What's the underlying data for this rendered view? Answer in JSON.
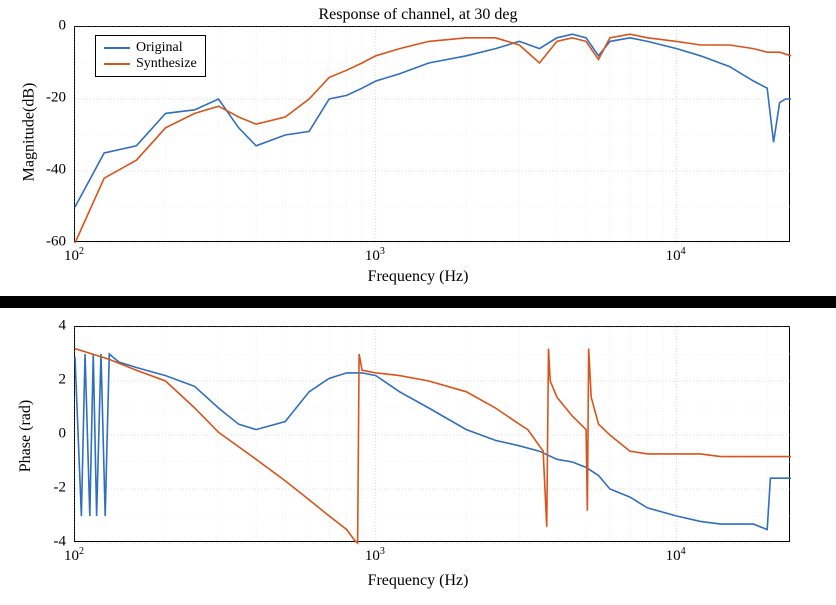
{
  "chart_data": [
    {
      "id": "top",
      "type": "line",
      "title": "Response of channel, at 30 deg",
      "xlabel": "Frequency (Hz)",
      "ylabel": "Magnitude(dB)",
      "x_scale": "log",
      "x_ticks": [
        100,
        1000,
        10000
      ],
      "x_tick_labels": [
        "10^2",
        "10^3",
        "10^4"
      ],
      "xlim": [
        100,
        24000
      ],
      "ylim": [
        -60,
        0
      ],
      "y_ticks": [
        -60,
        -40,
        -20,
        0
      ],
      "legend": {
        "items": [
          "Original",
          "Synthesize"
        ],
        "colors": [
          "#2f6fbe",
          "#d9541a"
        ]
      },
      "series": [
        {
          "name": "Original",
          "color": "#2f6fbe",
          "x": [
            100,
            125,
            160,
            200,
            250,
            300,
            350,
            400,
            500,
            600,
            700,
            800,
            900,
            1000,
            1200,
            1500,
            2000,
            2500,
            3000,
            3500,
            4000,
            4500,
            5000,
            5500,
            6000,
            7000,
            8000,
            10000,
            12000,
            15000,
            18000,
            20000,
            21000,
            22000,
            23000,
            24000
          ],
          "y": [
            -50,
            -35,
            -33,
            -24,
            -23,
            -20,
            -28,
            -33,
            -30,
            -29,
            -20,
            -19,
            -17,
            -15,
            -13,
            -10,
            -8,
            -6,
            -4,
            -6,
            -3,
            -2,
            -3,
            -8,
            -4,
            -3,
            -4,
            -6,
            -8,
            -11,
            -15,
            -17,
            -32,
            -21,
            -20,
            -20
          ]
        },
        {
          "name": "Synthesize",
          "color": "#d9541a",
          "x": [
            100,
            125,
            160,
            200,
            250,
            300,
            350,
            400,
            500,
            600,
            700,
            800,
            900,
            1000,
            1200,
            1500,
            2000,
            2500,
            3000,
            3500,
            4000,
            4500,
            5000,
            5500,
            6000,
            7000,
            8000,
            10000,
            12000,
            15000,
            18000,
            20000,
            22000,
            24000
          ],
          "y": [
            -60,
            -42,
            -37,
            -28,
            -24,
            -22,
            -25,
            -27,
            -25,
            -20,
            -14,
            -12,
            -10,
            -8,
            -6,
            -4,
            -3,
            -3,
            -5,
            -10,
            -4,
            -3,
            -4,
            -9,
            -3,
            -2,
            -3,
            -4,
            -5,
            -5,
            -6,
            -7,
            -7,
            -8
          ]
        }
      ]
    },
    {
      "id": "bottom",
      "type": "line",
      "xlabel": "Frequency (Hz)",
      "ylabel": "Phase (rad)",
      "x_scale": "log",
      "x_ticks": [
        100,
        1000,
        10000
      ],
      "x_tick_labels": [
        "10^2",
        "10^3",
        "10^4"
      ],
      "xlim": [
        100,
        24000
      ],
      "ylim": [
        -4,
        4
      ],
      "y_ticks": [
        -4,
        -2,
        0,
        2,
        4
      ],
      "series": [
        {
          "name": "Original",
          "color": "#2f6fbe",
          "x": [
            100,
            105,
            108,
            112,
            115,
            118,
            122,
            126,
            130,
            140,
            160,
            200,
            250,
            300,
            350,
            400,
            500,
            600,
            700,
            800,
            850,
            900,
            1000,
            1200,
            1500,
            2000,
            2500,
            3000,
            3500,
            4000,
            4500,
            5000,
            5500,
            6000,
            7000,
            8000,
            10000,
            12000,
            14000,
            16000,
            18000,
            20000,
            20500,
            21000,
            22000,
            23000,
            24000
          ],
          "y": [
            2.9,
            -3.0,
            3.0,
            -3.0,
            3.0,
            -3.0,
            3.0,
            -3.0,
            3.0,
            2.7,
            2.5,
            2.2,
            1.8,
            1.0,
            0.4,
            0.2,
            0.5,
            1.6,
            2.1,
            2.3,
            2.3,
            2.3,
            2.2,
            1.6,
            1.0,
            0.2,
            -0.2,
            -0.4,
            -0.6,
            -0.9,
            -1.0,
            -1.2,
            -1.5,
            -2.0,
            -2.3,
            -2.7,
            -3.0,
            -3.2,
            -3.3,
            -3.3,
            -3.3,
            -3.5,
            -1.6,
            -1.6,
            -1.6,
            -1.6,
            -1.6
          ]
        },
        {
          "name": "Synthesize",
          "color": "#d9541a",
          "x": [
            100,
            130,
            160,
            200,
            250,
            300,
            400,
            500,
            600,
            700,
            800,
            850,
            870,
            880,
            900,
            1000,
            1200,
            1500,
            2000,
            2500,
            3000,
            3200,
            3600,
            3700,
            3750,
            3800,
            4000,
            4500,
            5000,
            5050,
            5100,
            5200,
            5500,
            6000,
            7000,
            8000,
            10000,
            12000,
            14000,
            16000,
            18000,
            20000,
            22000,
            24000
          ],
          "y": [
            3.2,
            2.8,
            2.4,
            2.0,
            1.0,
            0.1,
            -0.9,
            -1.7,
            -2.4,
            -3.0,
            -3.5,
            -3.9,
            -4.0,
            3.0,
            2.4,
            2.3,
            2.2,
            2.0,
            1.6,
            1.0,
            0.4,
            0.2,
            -0.6,
            -3.4,
            3.2,
            2.0,
            1.4,
            0.7,
            0.2,
            -2.8,
            3.2,
            1.4,
            0.4,
            0.0,
            -0.6,
            -0.7,
            -0.7,
            -0.7,
            -0.8,
            -0.8,
            -0.8,
            -0.8,
            -0.8,
            -0.8
          ]
        }
      ]
    }
  ],
  "colors": {
    "original": "#2f6fbe",
    "synthesize": "#d9541a"
  },
  "labels": {
    "top_title": "Response of channel, at 30 deg",
    "top_ylabel": "Magnitude(dB)",
    "bottom_ylabel": "Phase (rad)",
    "xlabel": "Frequency (Hz)",
    "legend_original": "Original",
    "legend_synthesize": "Synthesize"
  }
}
